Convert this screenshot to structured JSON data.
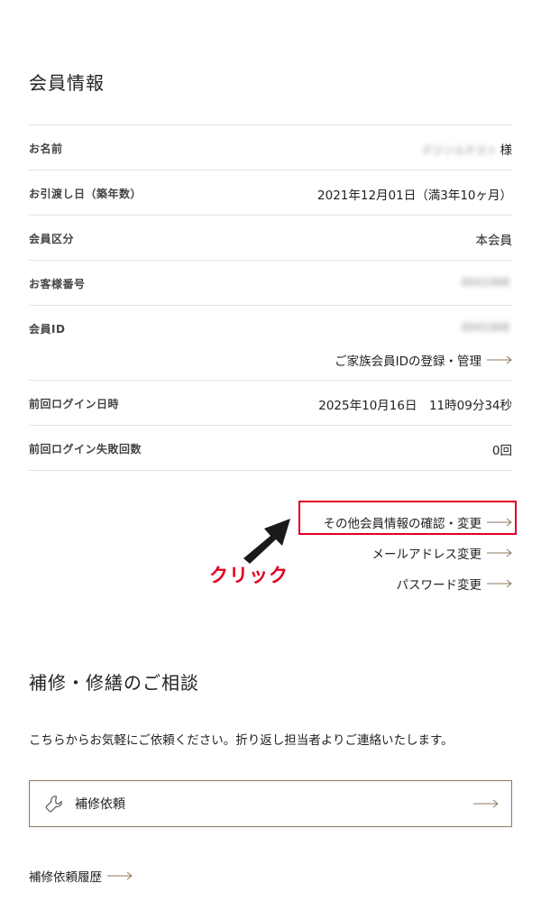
{
  "member_section": {
    "title": "会員情報",
    "rows": [
      {
        "label": "お名前",
        "value_blurred": "デジソルテスト",
        "suffix": "様"
      },
      {
        "label": "お引渡し日（築年数）",
        "value": "2021年12月01日（満3年10ヶ月）"
      },
      {
        "label": "会員区分",
        "value": "本会員"
      },
      {
        "label": "お客様番号",
        "value_blurred": "0041068"
      },
      {
        "label": "会員ID",
        "value_blurred": "0041068",
        "link": "ご家族会員IDの登録・管理"
      },
      {
        "label": "前回ログイン日時",
        "value": "2025年10月16日　11時09分34秒"
      },
      {
        "label": "前回ログイン失敗回数",
        "value": "0回"
      }
    ]
  },
  "links": {
    "other_info": "その他会員情報の確認・変更",
    "email_change": "メールアドレス変更",
    "password_change": "パスワード変更"
  },
  "annotation": {
    "click_label": "クリック",
    "color": "#e1001e"
  },
  "repair_section": {
    "title": "補修・修繕のご相談",
    "description": "こちらからお気軽にご依頼ください。折り返し担当者よりご連絡いたします。",
    "button_label": "補修依頼",
    "history_link": "補修依頼履歴"
  },
  "colors": {
    "accent_border": "#8c7a5b",
    "arrow": "#8c7a5b",
    "divider": "#e3e3e3"
  },
  "icons": {
    "link_arrow": "long-right-arrow-icon",
    "repair": "wrench-icon",
    "annotation": "pointer-arrow-icon"
  }
}
